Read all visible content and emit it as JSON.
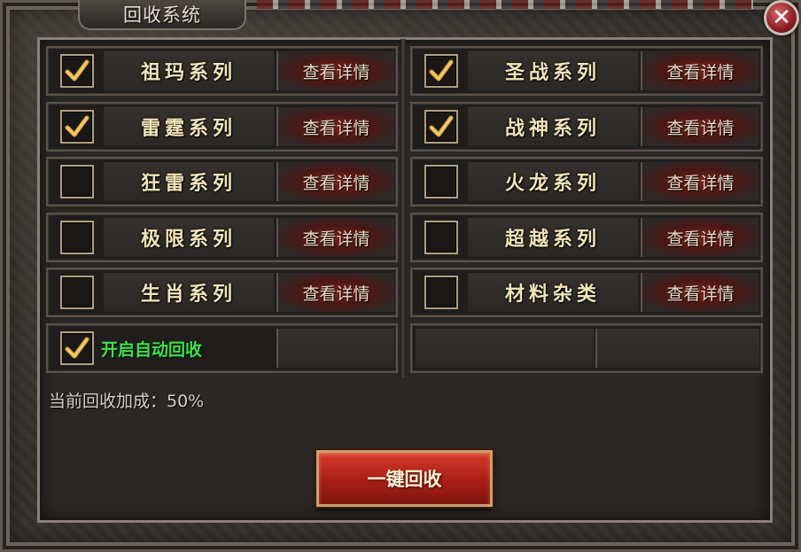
{
  "window": {
    "title": "回收系统",
    "close_label": "✕"
  },
  "series_rows": [
    {
      "left": {
        "name": "祖玛系列",
        "checked": true
      },
      "right": {
        "name": "圣战系列",
        "checked": true
      }
    },
    {
      "left": {
        "name": "雷霆系列",
        "checked": true
      },
      "right": {
        "name": "战神系列",
        "checked": true
      }
    },
    {
      "left": {
        "name": "狂雷系列",
        "checked": false
      },
      "right": {
        "name": "火龙系列",
        "checked": false
      }
    },
    {
      "left": {
        "name": "极限系列",
        "checked": false
      },
      "right": {
        "name": "超越系列",
        "checked": false
      }
    },
    {
      "left": {
        "name": "生肖系列",
        "checked": false
      },
      "right": {
        "name": "材料杂类",
        "checked": false
      }
    }
  ],
  "detail_button_label": "查看详情",
  "auto_recycle": {
    "label": "开启自动回收",
    "checked": true
  },
  "bonus": {
    "text": "当前回收加成：50%"
  },
  "recycle_button": {
    "label": "一键回收"
  },
  "colors": {
    "series_text": "#f2e4b8",
    "auto_label": "#3ee24a",
    "check_mark": "#d9a53c",
    "button_red": "#a81f16"
  },
  "icons": {
    "check": "check-icon",
    "close": "close-icon"
  }
}
